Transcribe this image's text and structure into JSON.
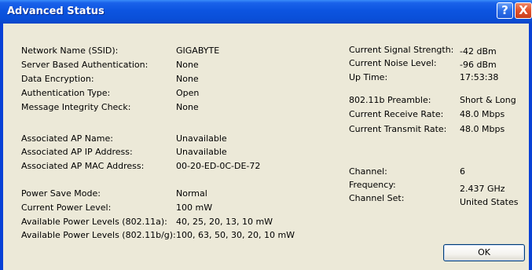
{
  "window": {
    "title": "Advanced Status",
    "help_glyph": "?",
    "close_glyph": "X"
  },
  "left": {
    "network_name": {
      "label": "Network Name (SSID):",
      "value": "GIGABYTE"
    },
    "server_auth": {
      "label": "Server Based Authentication:",
      "value": "None"
    },
    "data_encryption": {
      "label": "Data Encryption:",
      "value": "None"
    },
    "auth_type": {
      "label": "Authentication Type:",
      "value": "Open"
    },
    "msg_integrity": {
      "label": "Message Integrity Check:",
      "value": "None"
    },
    "ap_name": {
      "label": "Associated AP Name:",
      "value": "Unavailable"
    },
    "ap_ip": {
      "label": "Associated AP IP Address:",
      "value": "Unavailable"
    },
    "ap_mac": {
      "label": "Associated AP MAC Address:",
      "value": "00-20-ED-0C-DE-72"
    },
    "power_save": {
      "label": "Power Save Mode:",
      "value": "Normal"
    },
    "power_level": {
      "label": "Current Power Level:",
      "value": "100 mW"
    },
    "levels_a": {
      "label": "Available Power Levels (802.11a):",
      "value": "40, 25, 20, 13, 10 mW"
    },
    "levels_bg": {
      "label": "Available Power Levels (802.11b/g):",
      "value": "100, 63, 50, 30, 20, 10 mW"
    }
  },
  "right": {
    "signal": {
      "label": "Current Signal Strength:",
      "value": "-42 dBm"
    },
    "noise": {
      "label": "Current Noise Level:",
      "value": "-96 dBm"
    },
    "uptime": {
      "label": "Up Time:",
      "value": "17:53:38"
    },
    "preamble": {
      "label": "802.11b Preamble:",
      "value": "Short & Long"
    },
    "rx_rate": {
      "label": "Current Receive Rate:",
      "value": "48.0 Mbps"
    },
    "tx_rate": {
      "label": "Current Transmit Rate:",
      "value": "48.0 Mbps"
    },
    "channel": {
      "label": "Channel:",
      "value": "6"
    },
    "frequency": {
      "label": "Frequency:",
      "value": "2.437 GHz"
    },
    "channel_set": {
      "label": "Channel Set:",
      "value": "United States"
    }
  },
  "buttons": {
    "ok_label": "OK"
  },
  "colors": {
    "titlebar": "#0a4fd8",
    "client_bg": "#ece9d8",
    "close_button": "#e2512a"
  }
}
